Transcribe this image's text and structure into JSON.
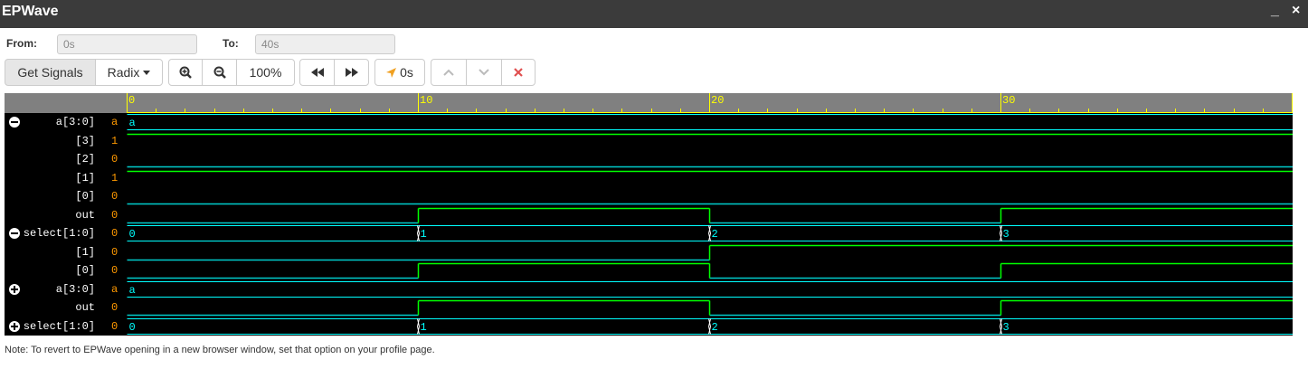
{
  "window": {
    "title": "EPWave",
    "minimize": "_",
    "close": "×"
  },
  "range": {
    "from_label": "From:",
    "from_value": "0s",
    "to_label": "To:",
    "to_value": "40s"
  },
  "toolbar": {
    "get_signals": "Get Signals",
    "radix": "Radix",
    "zoom_level": "100%",
    "cursor_time": "0s"
  },
  "ruler": {
    "labels": [
      "0",
      "10",
      "20",
      "30"
    ]
  },
  "colors": {
    "bus": "#00ffff",
    "bit_high": "#00ff00",
    "bit_low": "#00cccc",
    "ruler": "#ffff00",
    "value": "#ff9900"
  },
  "signals": [
    {
      "name": "a[3:0]",
      "value": "a",
      "kind": "bus",
      "expander": "minus-icon",
      "segments": [
        {
          "t": 0,
          "label": "a"
        }
      ]
    },
    {
      "name": "[3]",
      "value": "1",
      "kind": "bit",
      "levels": [
        {
          "t": 0,
          "v": 1
        }
      ]
    },
    {
      "name": "[2]",
      "value": "0",
      "kind": "bit",
      "levels": [
        {
          "t": 0,
          "v": 0
        }
      ]
    },
    {
      "name": "[1]",
      "value": "1",
      "kind": "bit",
      "levels": [
        {
          "t": 0,
          "v": 1
        }
      ]
    },
    {
      "name": "[0]",
      "value": "0",
      "kind": "bit",
      "levels": [
        {
          "t": 0,
          "v": 0
        }
      ]
    },
    {
      "name": "out",
      "value": "0",
      "kind": "bit",
      "levels": [
        {
          "t": 0,
          "v": 0
        },
        {
          "t": 10,
          "v": 1
        },
        {
          "t": 20,
          "v": 0
        },
        {
          "t": 30,
          "v": 1
        }
      ]
    },
    {
      "name": "select[1:0]",
      "value": "0",
      "kind": "bus",
      "expander": "minus-icon",
      "segments": [
        {
          "t": 0,
          "label": "0"
        },
        {
          "t": 10,
          "label": "1"
        },
        {
          "t": 20,
          "label": "2"
        },
        {
          "t": 30,
          "label": "3"
        }
      ]
    },
    {
      "name": "[1]",
      "value": "0",
      "kind": "bit",
      "levels": [
        {
          "t": 0,
          "v": 0
        },
        {
          "t": 20,
          "v": 1
        }
      ]
    },
    {
      "name": "[0]",
      "value": "0",
      "kind": "bit",
      "levels": [
        {
          "t": 0,
          "v": 0
        },
        {
          "t": 10,
          "v": 1
        },
        {
          "t": 20,
          "v": 0
        },
        {
          "t": 30,
          "v": 1
        }
      ]
    },
    {
      "name": "a[3:0]",
      "value": "a",
      "kind": "bus",
      "expander": "plus-icon",
      "segments": [
        {
          "t": 0,
          "label": "a"
        }
      ]
    },
    {
      "name": "out",
      "value": "0",
      "kind": "bit",
      "levels": [
        {
          "t": 0,
          "v": 0
        },
        {
          "t": 10,
          "v": 1
        },
        {
          "t": 20,
          "v": 0
        },
        {
          "t": 30,
          "v": 1
        }
      ]
    },
    {
      "name": "select[1:0]",
      "value": "0",
      "kind": "bus",
      "expander": "plus-icon",
      "segments": [
        {
          "t": 0,
          "label": "0"
        },
        {
          "t": 10,
          "label": "1"
        },
        {
          "t": 20,
          "label": "2"
        },
        {
          "t": 30,
          "label": "3"
        }
      ]
    }
  ],
  "note": "Note: To revert to EPWave opening in a new browser window, set that option on your profile page."
}
